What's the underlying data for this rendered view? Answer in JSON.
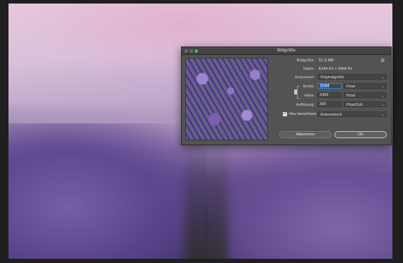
{
  "dialog": {
    "title": "Bildgröße",
    "image_size_label": "Bildgröße:",
    "image_size_value": "51,3 MB",
    "dimensions_label": "Maße:",
    "dimensions_value": "5184 Px  ×  3456 Px",
    "fit_label": "Einpassen:",
    "fit_value": "Originalgröße",
    "width_label": "Breite:",
    "width_value": "5184",
    "width_unit": "Pixel",
    "height_label": "Höhe:",
    "height_value": "3456",
    "height_unit": "Pixel",
    "resolution_label": "Auflösung:",
    "resolution_value": "300",
    "resolution_unit": "Pixel/Zoll",
    "resample_label": "Neu berechnen:",
    "resample_value": "Automatisch",
    "resample_checked": true,
    "cancel_label": "Abbrechen",
    "ok_label": "OK",
    "icons": {
      "settings": "gear-icon",
      "link": "chain-link-icon",
      "checkbox": "checkmark",
      "dropdown": "chevron-down-icon"
    }
  },
  "colors": {
    "dialog_bg": "#535353",
    "maximize": "#27c93f",
    "selection": "#2f65c0"
  }
}
